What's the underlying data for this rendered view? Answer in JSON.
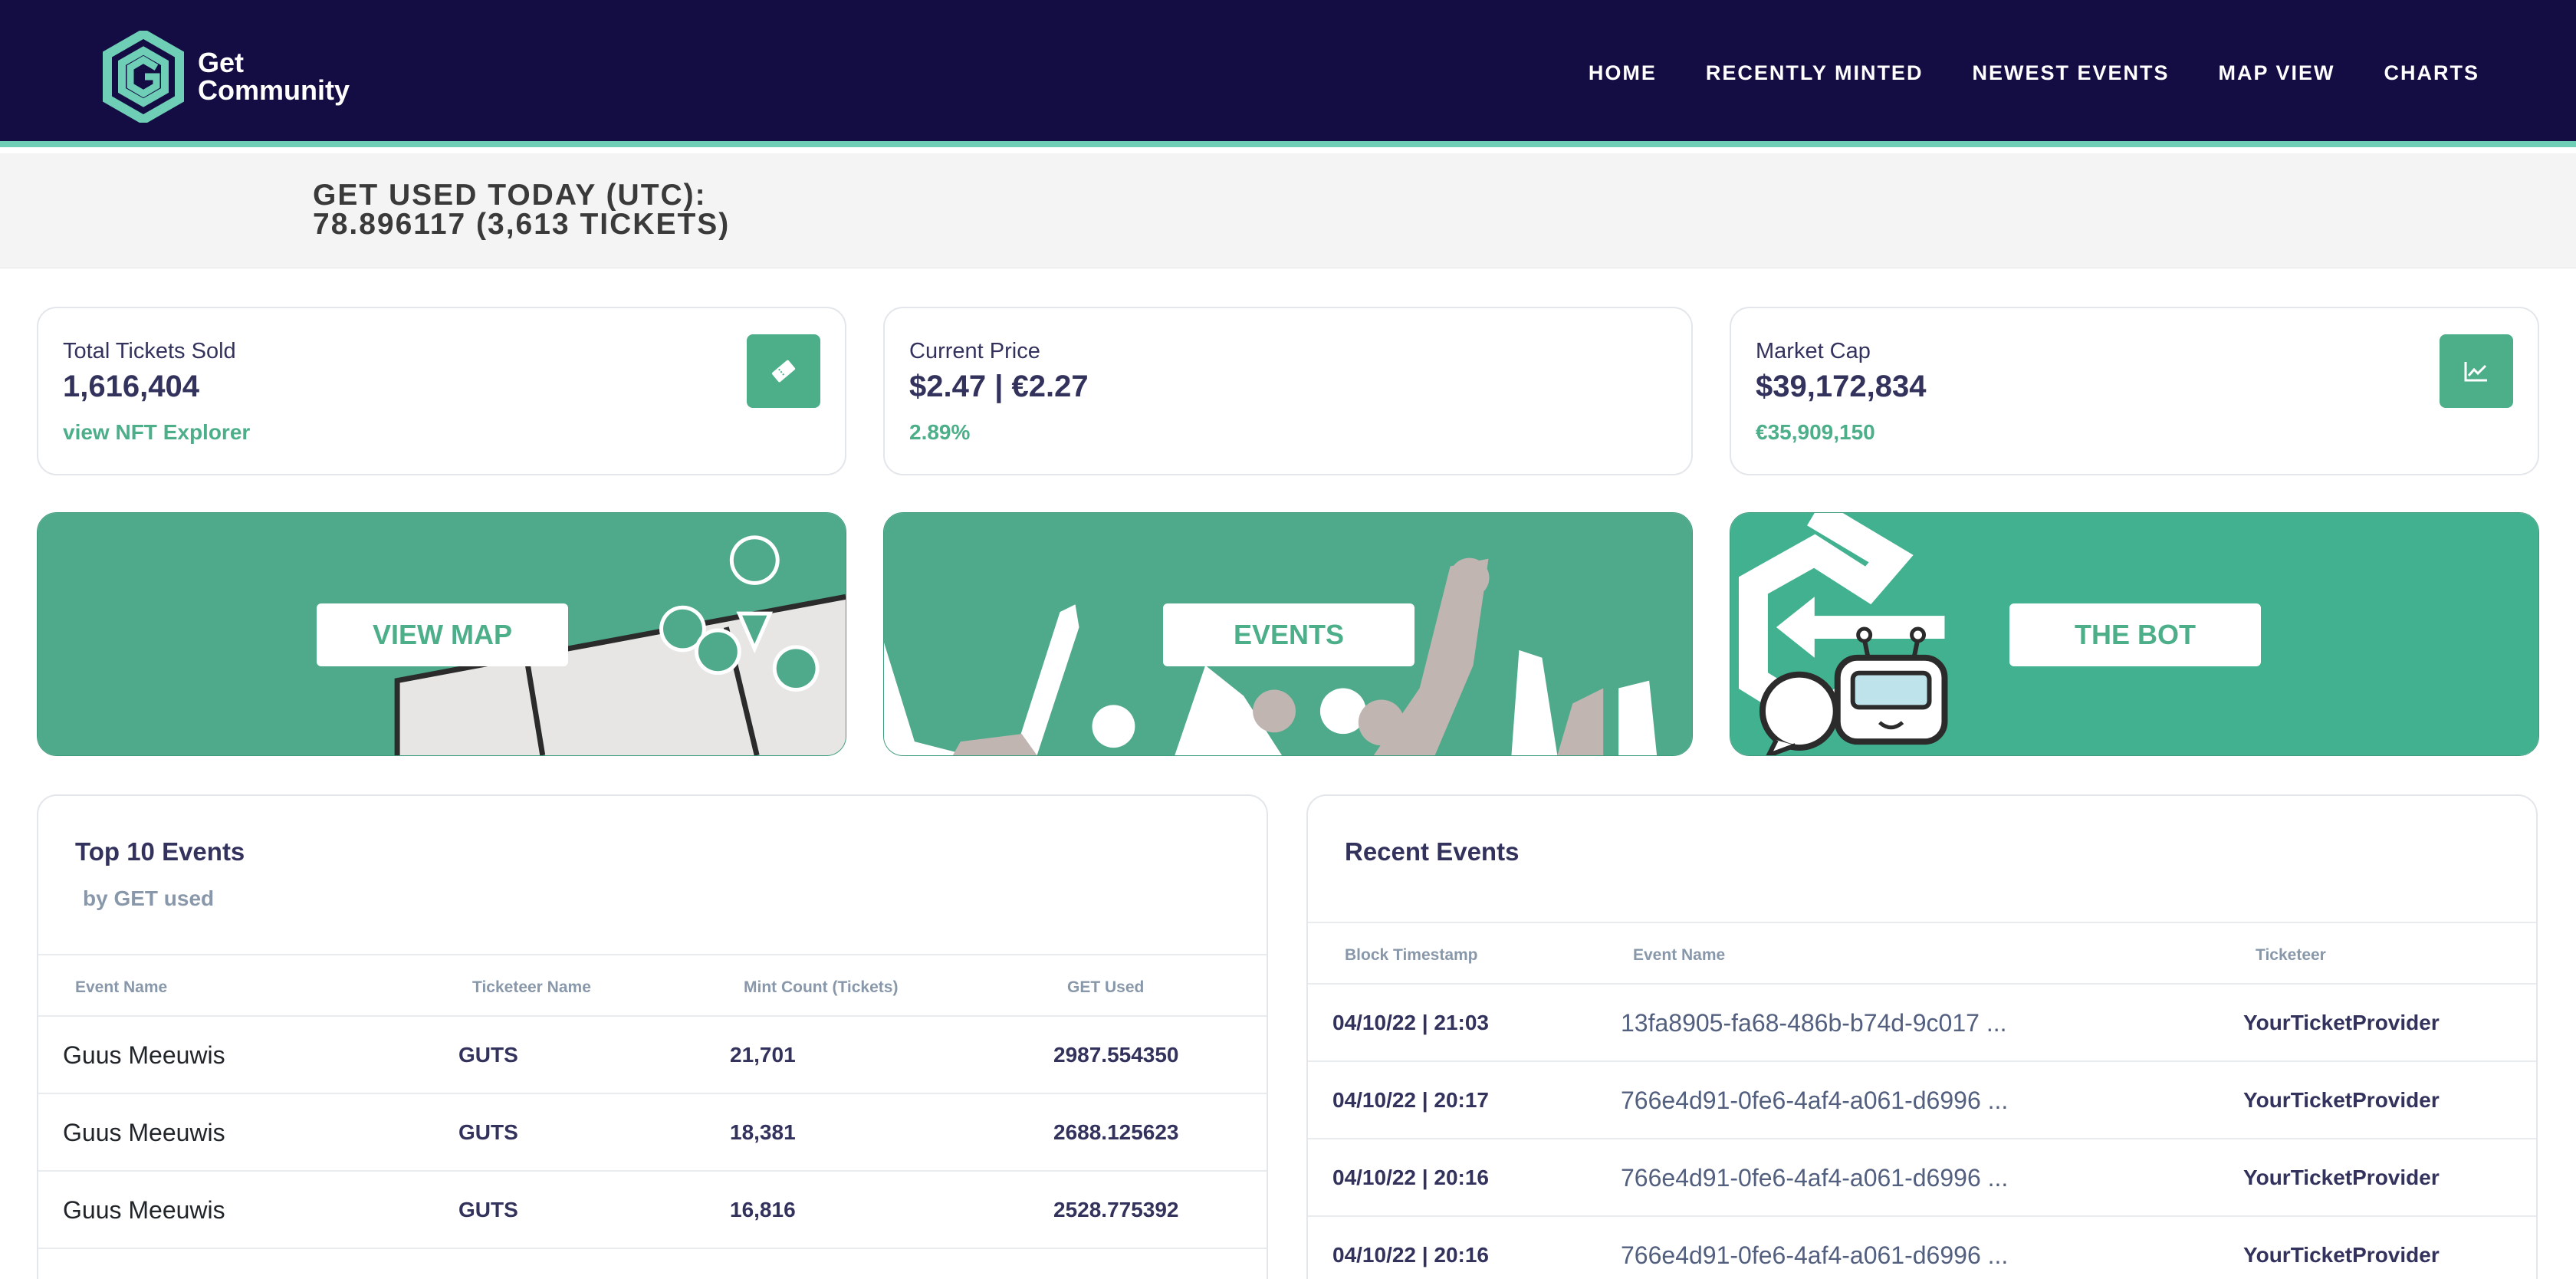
{
  "brand": {
    "line1": "Get",
    "line2": "Community"
  },
  "nav": [
    "HOME",
    "RECENTLY MINTED",
    "NEWEST EVENTS",
    "MAP VIEW",
    "CHARTS"
  ],
  "today": {
    "line1": "GET USED TODAY (UTC):",
    "line2": "78.896117 (3,613 TICKETS)"
  },
  "stats": {
    "tickets": {
      "title": "Total Tickets Sold",
      "value": "1,616,404",
      "sub": "view NFT Explorer",
      "icon": "ticket-icon"
    },
    "price": {
      "title": "Current Price",
      "value": "$2.47 | €2.27",
      "sub": "2.89%"
    },
    "cap": {
      "title": "Market Cap",
      "value": "$39,172,834",
      "sub": "€35,909,150",
      "icon": "chart-line-icon"
    }
  },
  "banners": {
    "map": "VIEW MAP",
    "events": "EVENTS",
    "bot": "THE BOT"
  },
  "top10": {
    "title": "Top 10 Events",
    "subtitle": "by GET used",
    "headers": [
      "Event Name",
      "Ticketeer Name",
      "Mint Count (Tickets)",
      "GET Used"
    ],
    "rows": [
      [
        "Guus Meeuwis",
        "GUTS",
        "21,701",
        "2987.554350"
      ],
      [
        "Guus Meeuwis",
        "GUTS",
        "18,381",
        "2688.125623"
      ],
      [
        "Guus Meeuwis",
        "GUTS",
        "16,816",
        "2528.775392"
      ]
    ]
  },
  "recent": {
    "title": "Recent Events",
    "headers": [
      "Block Timestamp",
      "Event Name",
      "Ticketeer"
    ],
    "rows": [
      [
        "04/10/22 | 21:03",
        "13fa8905-fa68-486b-b74d-9c017 ...",
        "YourTicketProvider"
      ],
      [
        "04/10/22 | 20:17",
        "766e4d91-0fe6-4af4-a061-d6996 ...",
        "YourTicketProvider"
      ],
      [
        "04/10/22 | 20:16",
        "766e4d91-0fe6-4af4-a061-d6996 ...",
        "YourTicketProvider"
      ],
      [
        "04/10/22 | 20:16",
        "766e4d91-0fe6-4af4-a061-d6996 ...",
        "YourTicketProvider"
      ]
    ]
  },
  "colors": {
    "navy": "#140d44",
    "accent": "#4caf8a",
    "mint": "#6ecfb6"
  }
}
